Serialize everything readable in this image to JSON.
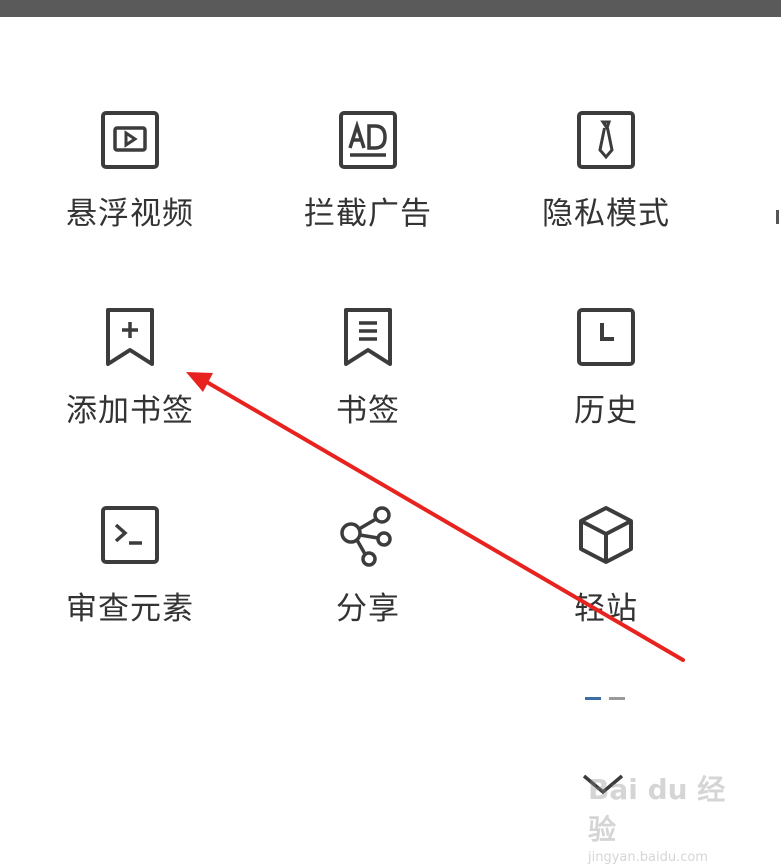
{
  "menu": {
    "items": [
      {
        "label": "悬浮视频",
        "icon": "floating-video-icon"
      },
      {
        "label": "拦截广告",
        "icon": "ad-block-icon"
      },
      {
        "label": "隐私模式",
        "icon": "privacy-mode-icon"
      },
      {
        "label": "添加书签",
        "icon": "add-bookmark-icon"
      },
      {
        "label": "书签",
        "icon": "bookmark-icon"
      },
      {
        "label": "历史",
        "icon": "history-icon"
      },
      {
        "label": "审查元素",
        "icon": "inspect-element-icon"
      },
      {
        "label": "分享",
        "icon": "share-icon"
      },
      {
        "label": "轻站",
        "icon": "light-site-icon"
      }
    ]
  },
  "pager": {
    "current_page": 1,
    "total_pages": 2
  },
  "colors": {
    "annotation_arrow": "#e8231f",
    "icon_stroke": "#3c3c3c",
    "label_text": "#333333",
    "active_dot": "#3a6ea5"
  },
  "watermark": {
    "logo": "Bai du 经验",
    "url": "jingyan.baidu.com"
  }
}
